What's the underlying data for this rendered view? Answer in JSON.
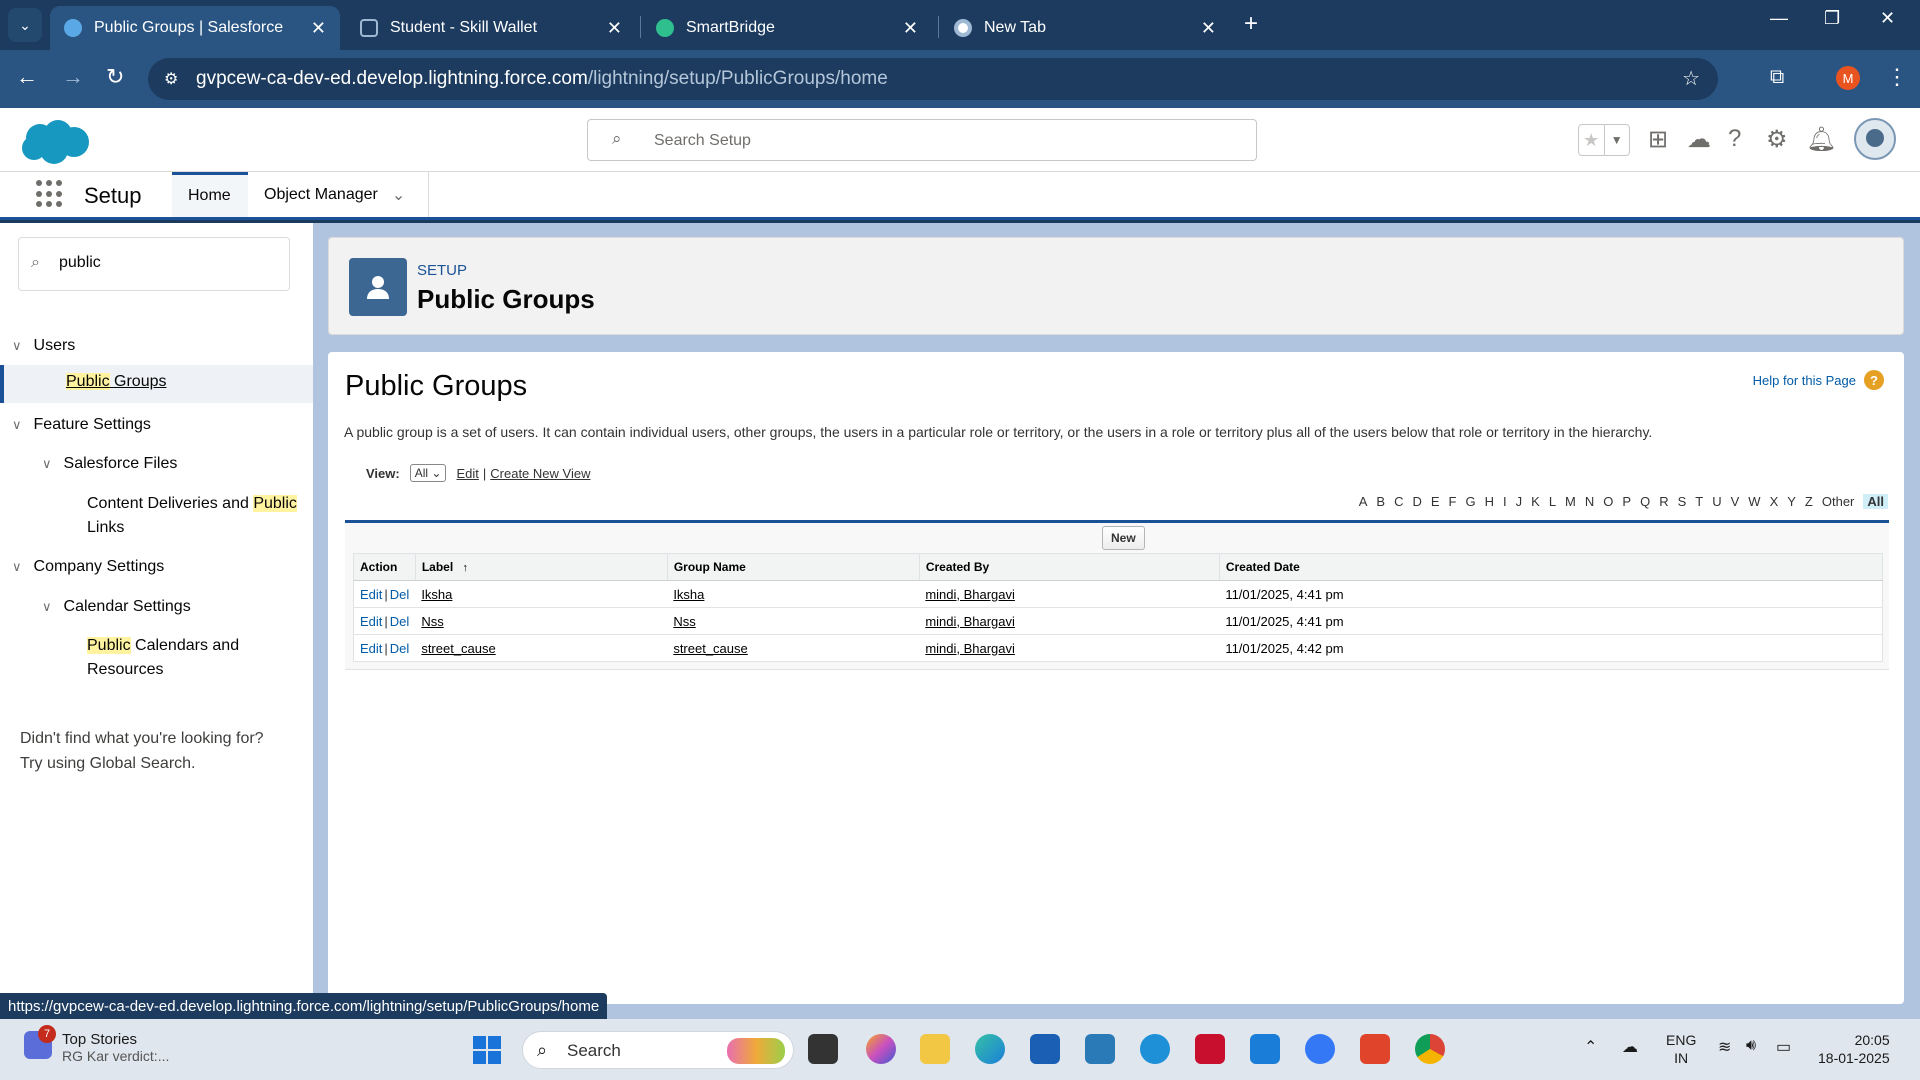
{
  "browser": {
    "tabs": [
      {
        "title": "Public Groups | Salesforce",
        "active": true
      },
      {
        "title": "Student - Skill Wallet",
        "active": false
      },
      {
        "title": "SmartBridge",
        "active": false
      },
      {
        "title": "New Tab",
        "active": false
      }
    ],
    "url_host": "gvpcew-ca-dev-ed.develop.lightning.force.com",
    "url_path": "/lightning/setup/PublicGroups/home",
    "profile_initial": "M",
    "status_url": "https://gvpcew-ca-dev-ed.develop.lightning.force.com/lightning/setup/PublicGroups/home"
  },
  "sf_header": {
    "search_placeholder": "Search Setup",
    "app_name": "Setup",
    "nav_tabs": [
      "Home",
      "Object Manager"
    ]
  },
  "sidebar": {
    "quick_find_value": "public",
    "tree": {
      "users": "Users",
      "public_groups_a": "Public",
      "public_groups_b": " Groups",
      "feature_settings": "Feature Settings",
      "salesforce_files": "Salesforce Files",
      "content_deliveries_a": "Content Deliveries and ",
      "content_deliveries_b": "Public",
      "content_deliveries_c": "Links",
      "company_settings": "Company Settings",
      "calendar_settings": "Calendar Settings",
      "public_calendars_a": "Public",
      "public_calendars_b": " Calendars and",
      "public_calendars_c": "Resources"
    },
    "not_found_line1": "Didn't find what you're looking for?",
    "not_found_line2": "Try using Global Search."
  },
  "page_header": {
    "eyebrow": "SETUP",
    "title": "Public Groups"
  },
  "content": {
    "title": "Public Groups",
    "help_link": "Help for this Page",
    "description": "A public group is a set of users. It can contain individual users, other groups, the users in a particular role or territory, or the users in a role or territory plus all of the users below that role or territory in the hierarchy.",
    "view_label": "View:",
    "view_selected": "All",
    "edit_link": "Edit",
    "create_view_link": "Create New View",
    "alphabet": [
      "A",
      "B",
      "C",
      "D",
      "E",
      "F",
      "G",
      "H",
      "I",
      "J",
      "K",
      "L",
      "M",
      "N",
      "O",
      "P",
      "Q",
      "R",
      "S",
      "T",
      "U",
      "V",
      "W",
      "X",
      "Y",
      "Z",
      "Other",
      "All"
    ],
    "new_button": "New",
    "columns": [
      "Action",
      "Label",
      "Group Name",
      "Created By",
      "Created Date"
    ],
    "sort_indicator": "↑",
    "action_edit": "Edit",
    "action_del": "Del",
    "rows": [
      {
        "label": "Iksha",
        "group_name": "Iksha",
        "created_by": "mindi, Bhargavi",
        "created_date": "11/01/2025, 4:41 pm"
      },
      {
        "label": "Nss",
        "group_name": "Nss",
        "created_by": "mindi, Bhargavi",
        "created_date": "11/01/2025, 4:41 pm"
      },
      {
        "label": "street_cause",
        "group_name": "street_cause",
        "created_by": "mindi, Bhargavi",
        "created_date": "11/01/2025, 4:42 pm"
      }
    ]
  },
  "taskbar": {
    "news_badge": "7",
    "news_title": "Top Stories",
    "news_sub": "RG Kar verdict:...",
    "search_label": "Search",
    "lang_1": "ENG",
    "lang_2": "IN",
    "time": "20:05",
    "date": "18-01-2025"
  },
  "colors": {
    "brand": "#1b5297",
    "link": "#015ba7"
  }
}
